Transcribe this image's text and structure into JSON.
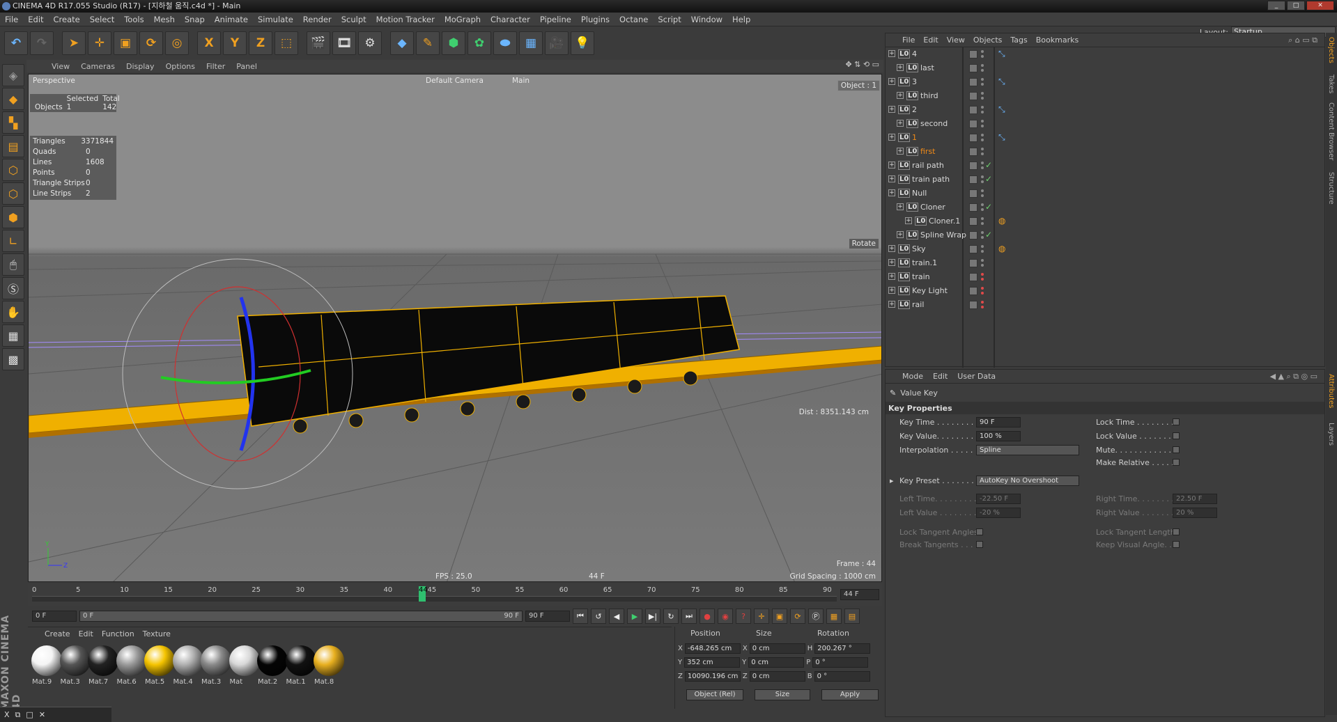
{
  "window": {
    "title": "CINEMA 4D R17.055 Studio (R17) - [지하철 움직.c4d *] - Main"
  },
  "menubar": [
    "File",
    "Edit",
    "Create",
    "Select",
    "Tools",
    "Mesh",
    "Snap",
    "Animate",
    "Simulate",
    "Render",
    "Sculpt",
    "Motion Tracker",
    "MoGraph",
    "Character",
    "Pipeline",
    "Plugins",
    "Octane",
    "Script",
    "Window",
    "Help"
  ],
  "layout": {
    "label": "Layout:",
    "value": "Startup"
  },
  "viewport": {
    "menu": [
      "View",
      "Cameras",
      "Display",
      "Options",
      "Filter",
      "Panel"
    ],
    "label": "Perspective",
    "camera": "Default Camera",
    "main": "Main",
    "object": "Object : 1",
    "rotate": "Rotate",
    "dist": "Dist : 8351.143 cm",
    "fps": "FPS : 25.0",
    "frame_mid": "44 F",
    "frame": "Frame : 44",
    "grid": "Grid Spacing : 1000 cm",
    "stats_header": [
      "Selected",
      "Total"
    ],
    "stats_objects": {
      "label": "Objects",
      "selected": "1",
      "total": "142"
    },
    "stats": [
      {
        "label": "Triangles",
        "value": "3371844"
      },
      {
        "label": "Quads",
        "value": "0"
      },
      {
        "label": "Lines",
        "value": "1608"
      },
      {
        "label": "Points",
        "value": "0"
      },
      {
        "label": "Triangle Strips",
        "value": "0"
      },
      {
        "label": "Line Strips",
        "value": "2"
      }
    ]
  },
  "timeline": {
    "ticks": [
      "0",
      "5",
      "10",
      "15",
      "20",
      "25",
      "30",
      "35",
      "40",
      "45",
      "50",
      "55",
      "60",
      "65",
      "70",
      "75",
      "80",
      "85",
      "90"
    ],
    "current": "44",
    "current_fraction": 0.489,
    "end_field": "44 F",
    "start_field": "0 F",
    "range_start": "0 F",
    "range_end": "90 F",
    "max_field": "90 F"
  },
  "materials": {
    "menu": [
      "Create",
      "Edit",
      "Function",
      "Texture"
    ],
    "items": [
      {
        "name": "Mat.9",
        "color": "#f4f4f4"
      },
      {
        "name": "Mat.3",
        "color": "#555555"
      },
      {
        "name": "Mat.7",
        "color": "#222222"
      },
      {
        "name": "Mat.6",
        "color": "#9a9a9a"
      },
      {
        "name": "Mat.5",
        "color": "#f5c400"
      },
      {
        "name": "Mat.4",
        "color": "#b0b0b0"
      },
      {
        "name": "Mat.3",
        "color": "#8a8a8a"
      },
      {
        "name": "Mat",
        "color": "#d8d8d8"
      },
      {
        "name": "Mat.2",
        "color": "#050505"
      },
      {
        "name": "Mat.1",
        "color": "#111111"
      },
      {
        "name": "Mat.8",
        "color": "#e8b020"
      }
    ]
  },
  "coords": {
    "headers": [
      "Position",
      "Size",
      "Rotation"
    ],
    "rows": [
      {
        "a": "X",
        "pos": "-648.265 cm",
        "b": "X",
        "size": "0 cm",
        "c": "H",
        "rot": "200.267 °"
      },
      {
        "a": "Y",
        "pos": "352 cm",
        "b": "Y",
        "size": "0 cm",
        "c": "P",
        "rot": "0 °"
      },
      {
        "a": "Z",
        "pos": "10090.196 cm",
        "b": "Z",
        "size": "0 cm",
        "c": "B",
        "rot": "0 °"
      }
    ],
    "mode": "Object (Rel)",
    "size_mode": "Size",
    "apply": "Apply"
  },
  "objects": {
    "menu": [
      "File",
      "Edit",
      "View",
      "Objects",
      "Tags",
      "Bookmarks"
    ],
    "rows": [
      {
        "name": "4",
        "indent": 0,
        "hl": false
      },
      {
        "name": "last",
        "indent": 1,
        "hl": false
      },
      {
        "name": "3",
        "indent": 0,
        "hl": false
      },
      {
        "name": "third",
        "indent": 1,
        "hl": false
      },
      {
        "name": "2",
        "indent": 0,
        "hl": false
      },
      {
        "name": "second",
        "indent": 1,
        "hl": false
      },
      {
        "name": "1",
        "indent": 0,
        "hl": true
      },
      {
        "name": "first",
        "indent": 1,
        "hl": true
      },
      {
        "name": "rail path",
        "indent": 0,
        "hl": false
      },
      {
        "name": "train path",
        "indent": 0,
        "hl": false
      },
      {
        "name": "Null",
        "indent": 0,
        "hl": false
      },
      {
        "name": "Cloner",
        "indent": 1,
        "hl": false
      },
      {
        "name": "Cloner.1",
        "indent": 2,
        "hl": false
      },
      {
        "name": "Spline Wrap",
        "indent": 1,
        "hl": false
      },
      {
        "name": "Sky",
        "indent": 0,
        "hl": false
      },
      {
        "name": "train.1",
        "indent": 0,
        "hl": false
      },
      {
        "name": "train",
        "indent": 0,
        "hl": false
      },
      {
        "name": "Key Light",
        "indent": 0,
        "hl": false
      },
      {
        "name": "rail",
        "indent": 0,
        "hl": false
      }
    ]
  },
  "attributes": {
    "menu": [
      "Mode",
      "Edit",
      "User Data"
    ],
    "title": "Value Key",
    "section": "Key Properties",
    "key_time_label": "Key Time . . . . . . . . .",
    "key_time": "90 F",
    "key_value_label": "Key Value. . . . . . . . .",
    "key_value": "100 %",
    "interp_label": "Interpolation . . . . . .",
    "interp": "Spline",
    "lock_time": "Lock Time . . . . . . . . .",
    "lock_value": "Lock Value . . . . . . . .",
    "mute": "Mute. . . . . . . . . . . . . .",
    "make_relative": "Make Relative . . . . .",
    "key_preset_label": "Key Preset . . . . . . . .",
    "key_preset": "AutoKey No Overshoot",
    "left_time_label": "Left  Time. . . . . . . . .",
    "left_time": "-22.50 F",
    "left_value_label": "Left  Value . . . . . . . .",
    "left_value": "-20 %",
    "right_time_label": "Right Time. . . . . . . .",
    "right_time": "22.50 F",
    "right_value_label": "Right Value . . . . . . .",
    "right_value": "20 %",
    "lock_tangent_angles": "Lock Tangent Angles",
    "break_tangents": "Break Tangents . . . .",
    "lock_tangent_lengths": "Lock Tangent Lengths",
    "keep_visual_angle": "Keep Visual Angle. . ."
  },
  "sidetabs": [
    "Objects",
    "Takes",
    "Content Browser",
    "Structure",
    "Attributes",
    "Layers"
  ],
  "maxon": "MAXON CINEMA 4D",
  "taskbar": {
    "label": "X"
  }
}
